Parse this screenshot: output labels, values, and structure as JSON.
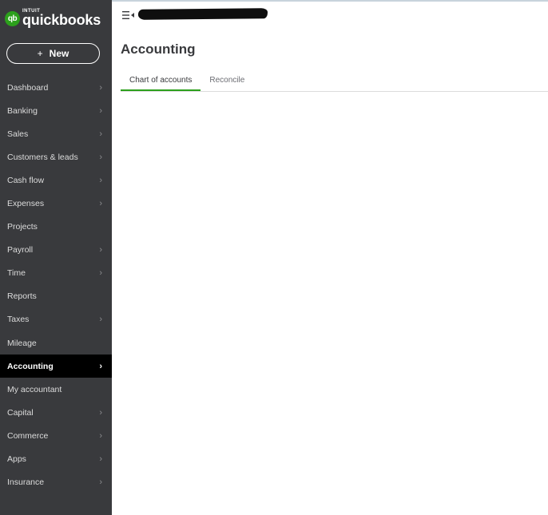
{
  "brand": {
    "intuit": "INTUIT",
    "name": "quickbooks",
    "logo_letters": "qb",
    "accent": "#2ca01c"
  },
  "new_button": {
    "plus": "+",
    "label": "New"
  },
  "sidebar": {
    "items": [
      {
        "label": "Dashboard",
        "chevron": true
      },
      {
        "label": "Banking",
        "chevron": true
      },
      {
        "label": "Sales",
        "chevron": true
      },
      {
        "label": "Customers & leads",
        "chevron": true
      },
      {
        "label": "Cash flow",
        "chevron": true
      },
      {
        "label": "Expenses",
        "chevron": true
      },
      {
        "label": "Projects",
        "chevron": false
      },
      {
        "label": "Payroll",
        "chevron": true
      },
      {
        "label": "Time",
        "chevron": true
      },
      {
        "label": "Reports",
        "chevron": false
      },
      {
        "label": "Taxes",
        "chevron": true
      },
      {
        "label": "Mileage",
        "chevron": false
      },
      {
        "label": "Accounting",
        "chevron": true,
        "active": true
      },
      {
        "label": "My accountant",
        "chevron": false
      },
      {
        "label": "Capital",
        "chevron": true
      },
      {
        "label": "Commerce",
        "chevron": true
      },
      {
        "label": "Apps",
        "chevron": true
      },
      {
        "label": "Insurance",
        "chevron": true
      }
    ]
  },
  "header": {
    "title": "Accounting"
  },
  "tabs": [
    {
      "label": "Chart of accounts",
      "active": true
    },
    {
      "label": "Reconcile",
      "active": false
    }
  ]
}
